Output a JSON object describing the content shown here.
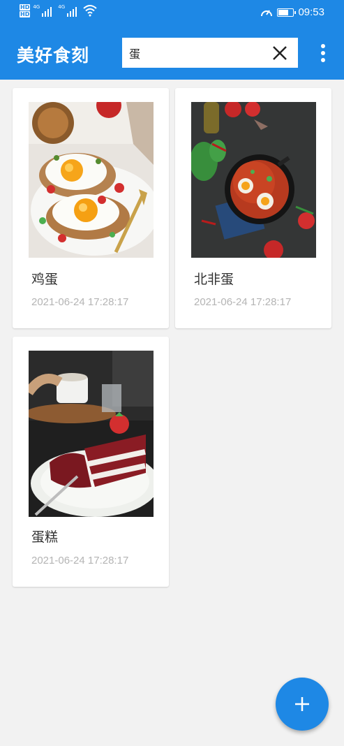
{
  "status_bar": {
    "network_badges": [
      "HD",
      "HD"
    ],
    "signal_labels": [
      "4G",
      "4G"
    ],
    "time": "09:53",
    "battery_level": 0.6
  },
  "toolbar": {
    "title": "美好食刻",
    "search_value": "蛋",
    "clear_icon": "close-icon",
    "menu_icon": "more-vert-icon"
  },
  "recipes": [
    {
      "name": "鸡蛋",
      "date": "2021-06-24 17:28:17"
    },
    {
      "name": "北非蛋",
      "date": "2021-06-24 17:28:17"
    },
    {
      "name": "蛋糕",
      "date": "2021-06-24 17:28:17"
    }
  ],
  "fab": {
    "icon": "plus-icon"
  },
  "colors": {
    "primary": "#1e88e5",
    "background": "#f2f2f2"
  }
}
